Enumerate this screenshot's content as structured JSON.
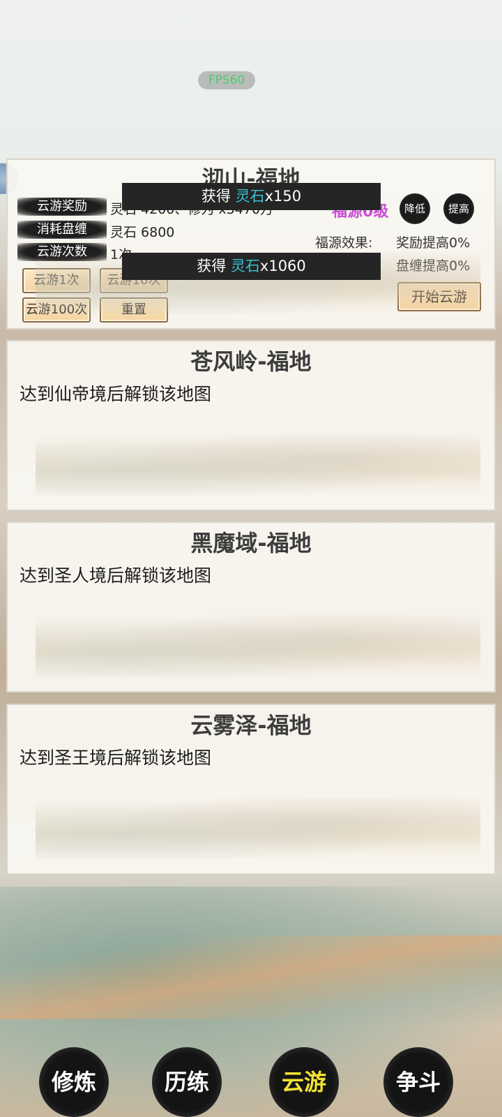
{
  "fps_label": "FPS60",
  "map1": {
    "title": "沏山-福地",
    "rows": [
      {
        "label": "云游奖励",
        "value": "灵石 4200、修为 x3470万"
      },
      {
        "label": "消耗盘缠",
        "value": "灵石 6800"
      },
      {
        "label": "云游次数",
        "value": "1次"
      }
    ],
    "level_label": "福源0级",
    "decrease_label": "降低",
    "increase_label": "提高",
    "effect_label": "福源效果:",
    "effect_reward": "奖励提高0%",
    "effect_cost": "盘缠提高0%",
    "btn_1x": "云游1次",
    "btn_10x": "云游10次",
    "btn_100x": "云游100次",
    "btn_reset": "重置",
    "btn_start": "开始云游"
  },
  "toasts": [
    {
      "prefix": "获得 ",
      "item": "灵石",
      "amount": "x150"
    },
    {
      "prefix": "获得 ",
      "item": "灵石",
      "amount": "x1060"
    }
  ],
  "locked_maps": [
    {
      "title": "苍风岭-福地",
      "message": "达到仙帝境后解锁该地图"
    },
    {
      "title": "黑魔域-福地",
      "message": "达到圣人境后解锁该地图"
    },
    {
      "title": "云雾泽-福地",
      "message": "达到圣王境后解锁该地图"
    }
  ],
  "nav": {
    "cultivate": "修炼",
    "train": "历练",
    "travel": "云游",
    "battle": "争斗",
    "active": "travel"
  },
  "colors": {
    "level_text": "#c94fd6",
    "toast_highlight": "#39c0d4",
    "nav_active": "#f2e233",
    "fps_text": "#4ecb73"
  }
}
